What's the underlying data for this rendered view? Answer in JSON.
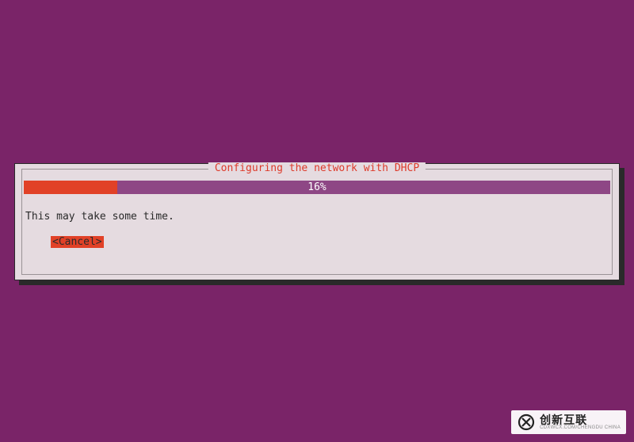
{
  "dialog": {
    "title": "Configuring the network with DHCP",
    "progress_percent": 16,
    "progress_label": "16%",
    "message": "This may take some time.",
    "cancel_label": "<Cancel>"
  },
  "watermark": {
    "brand": "创新互联",
    "tagline": "CDXWCX.COM/CHENGDU CHINA"
  },
  "colors": {
    "background": "#7a2468",
    "dialog_bg": "#e5dbe0",
    "accent_red": "#e14127",
    "accent_purple": "#8e4785",
    "title_red": "#dd3a2a"
  }
}
